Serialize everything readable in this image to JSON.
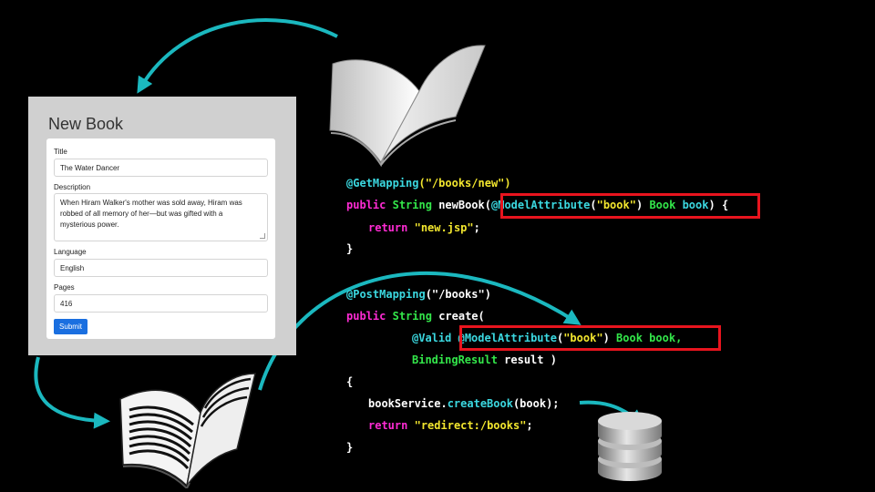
{
  "form": {
    "heading": "New Book",
    "title_label": "Title",
    "title_value": "The Water Dancer",
    "description_label": "Description",
    "description_lines": [
      "When Hiram Walker's mother was sold away, Hiram was",
      "robbed of all memory of her—but was gifted with a",
      "mysterious power."
    ],
    "language_label": "Language",
    "language_value": "English",
    "pages_label": "Pages",
    "pages_value": "416",
    "submit_label": "Submit"
  },
  "code": {
    "get_mapping": {
      "annotation": "@GetMapping",
      "path": "(\"/books/new\")",
      "line2_public": "public",
      "line2_string": "String",
      "line2_method": "newBook",
      "line2_model_attr": "@ModelAttribute",
      "line2_model_open": "(",
      "line2_model_name": "\"book\"",
      "line2_model_close": ")",
      "line2_type": "Book",
      "line2_param": "book",
      "line2_paren": ")",
      "line2_brace": "{",
      "return_kw": "return",
      "return_value": "\"new.jsp\"",
      "return_semi": ";",
      "close_brace": "}"
    },
    "post_mapping": {
      "annotation": "@PostMapping",
      "path": "(\"/books\")",
      "line2_public": "public",
      "line2_string": "String",
      "line2_method": "create(",
      "valid": "@Valid",
      "model_attr": "@ModelAttribute",
      "model_open": "(",
      "model_name": "\"book\"",
      "model_close": ")",
      "param_type": "Book",
      "param_name": "book,",
      "binding_type": "BindingResult",
      "binding_name": "result )",
      "open_brace": "{",
      "service_obj": "bookService.",
      "service_call": "createBook",
      "service_args": "(book);",
      "return_kw": "return",
      "return_value": "\"redirect:/books\"",
      "return_semi": ";",
      "close_brace": "}"
    }
  },
  "colors": {
    "arrow": "#1bb8bf",
    "highlight_box": "#e8141e",
    "annotation": "#3bd8e0",
    "keyword": "#ff2bd4",
    "type": "#33e64a",
    "string": "#f2e62e"
  },
  "icons": [
    "open-book-icon",
    "flipping-book-icon",
    "database-icon"
  ]
}
